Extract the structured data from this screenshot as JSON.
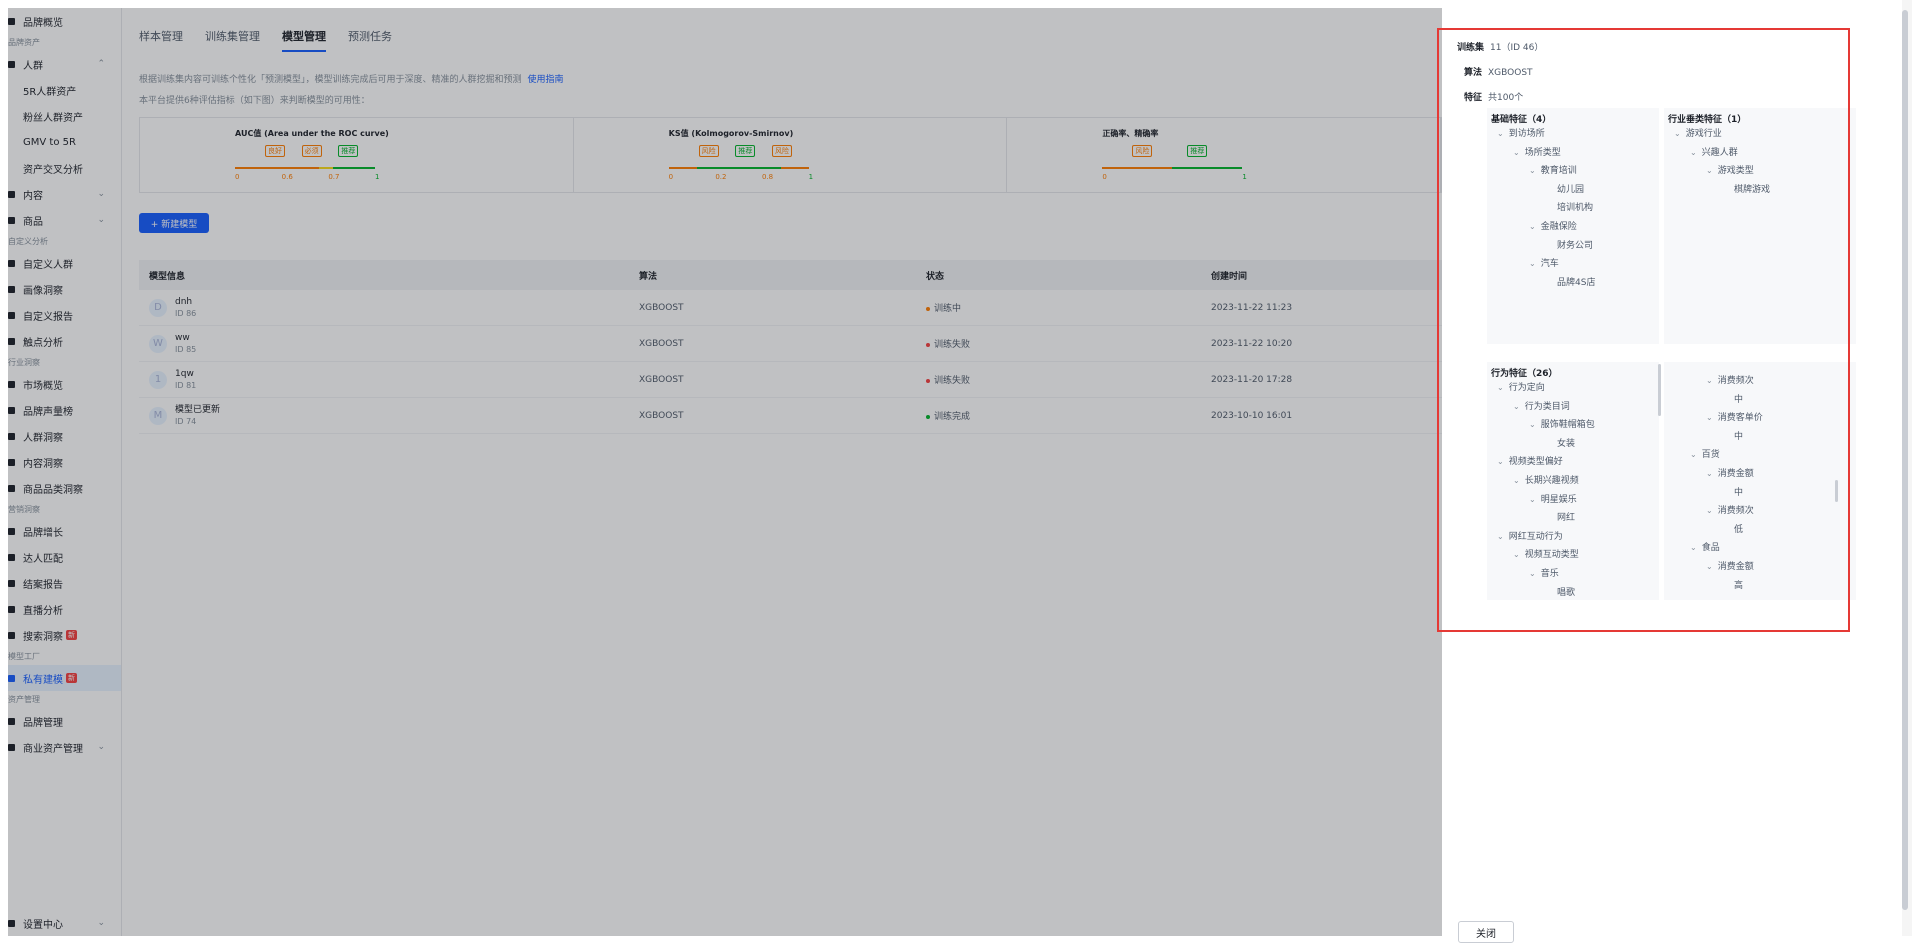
{
  "sidebar": {
    "entries": [
      {
        "type": "item",
        "label": "品牌概览"
      },
      {
        "type": "group",
        "label": "品牌资产"
      },
      {
        "type": "item",
        "label": "人群",
        "chev": "^"
      },
      {
        "type": "sub",
        "label": "5R人群资产"
      },
      {
        "type": "sub",
        "label": "粉丝人群资产"
      },
      {
        "type": "sub",
        "label": "GMV to 5R"
      },
      {
        "type": "sub",
        "label": "资产交叉分析"
      },
      {
        "type": "item",
        "label": "内容",
        "chev": "v"
      },
      {
        "type": "item",
        "label": "商品",
        "chev": "v"
      },
      {
        "type": "group",
        "label": "自定义分析"
      },
      {
        "type": "item",
        "label": "自定义人群"
      },
      {
        "type": "item",
        "label": "画像洞察"
      },
      {
        "type": "item",
        "label": "自定义报告"
      },
      {
        "type": "item",
        "label": "触点分析"
      },
      {
        "type": "group",
        "label": "行业洞察"
      },
      {
        "type": "item",
        "label": "市场概览"
      },
      {
        "type": "item",
        "label": "品牌声量榜"
      },
      {
        "type": "item",
        "label": "人群洞察"
      },
      {
        "type": "item",
        "label": "内容洞察"
      },
      {
        "type": "item",
        "label": "商品品类洞察"
      },
      {
        "type": "group",
        "label": "营销洞察"
      },
      {
        "type": "item",
        "label": "品牌增长"
      },
      {
        "type": "item",
        "label": "达人匹配"
      },
      {
        "type": "item",
        "label": "结案报告"
      },
      {
        "type": "item",
        "label": "直播分析"
      },
      {
        "type": "item",
        "label": "搜索洞察",
        "tag": "新"
      },
      {
        "type": "group",
        "label": "模型工厂"
      },
      {
        "type": "item",
        "label": "私有建模",
        "tag": "新",
        "active": true
      },
      {
        "type": "group",
        "label": "资产管理"
      },
      {
        "type": "item",
        "label": "品牌管理"
      },
      {
        "type": "item",
        "label": "商业资产管理",
        "chev": "v"
      }
    ],
    "settings_label": "设置中心"
  },
  "tabs": [
    "样本管理",
    "训练集管理",
    "模型管理",
    "预测任务"
  ],
  "active_tab_index": 2,
  "description": "根据训练集内容可训练个性化「预测模型」，模型训练完成后可用于深度、精准的人群挖掘和预测",
  "guide_link": "使用指南",
  "description2": "本平台提供6种评估指标（如下图）来判断模型的可用性：",
  "metrics": [
    {
      "title": "AUC值 (Area under the ROC curve)",
      "labels": [
        "良好",
        "必须",
        "推荐"
      ],
      "ticks": [
        "0",
        "0.6",
        "0.7",
        "1"
      ]
    },
    {
      "title": "KS值 (Kolmogorov-Smirnov)",
      "labels": [
        "风险",
        "推荐",
        "风险"
      ],
      "ticks": [
        "0",
        "0.2",
        "0.8",
        "1"
      ]
    },
    {
      "title": "正确率、精确率",
      "labels": [
        "风险",
        "推荐"
      ],
      "ticks": [
        "0",
        "1"
      ]
    }
  ],
  "new_model_button": "+ 新建模型",
  "table": {
    "headers": [
      "模型信息",
      "算法",
      "状态",
      "创建时间"
    ],
    "rows": [
      {
        "avatar": "D",
        "name": "dnh",
        "id": "ID 86",
        "algo": "XGBOOST",
        "status": "训练中",
        "status_color": "#ff7d00",
        "time": "2023-11-22 11:23"
      },
      {
        "avatar": "W",
        "name": "ww",
        "id": "ID 85",
        "algo": "XGBOOST",
        "status": "训练失败",
        "status_color": "#f53f3f",
        "time": "2023-11-22 10:20"
      },
      {
        "avatar": "1",
        "name": "1qw",
        "id": "ID 81",
        "algo": "XGBOOST",
        "status": "训练失败",
        "status_color": "#f53f3f",
        "time": "2023-11-20 17:28"
      },
      {
        "avatar": "M",
        "name": "模型已更新",
        "id": "ID 74",
        "algo": "XGBOOST",
        "status": "训练完成",
        "status_color": "#00b42a",
        "time": "2023-10-10 16:01"
      }
    ]
  },
  "drawer": {
    "training_set_label": "训练集",
    "training_set_value": "11（ID 46）",
    "algo_label": "算法",
    "algo_value": "XGBOOST",
    "feature_label": "特征",
    "feature_value": "共100个",
    "basic_title": "基础特征（4）",
    "basic_tree": [
      {
        "d": 0,
        "t": "到访场所",
        "c": true
      },
      {
        "d": 1,
        "t": "场所类型",
        "c": true
      },
      {
        "d": 2,
        "t": "教育培训",
        "c": true
      },
      {
        "d": 3,
        "t": "幼儿园"
      },
      {
        "d": 3,
        "t": "培训机构"
      },
      {
        "d": 2,
        "t": "金融保险",
        "c": true
      },
      {
        "d": 3,
        "t": "财务公司"
      },
      {
        "d": 2,
        "t": "汽车",
        "c": true
      },
      {
        "d": 3,
        "t": "品牌4S店"
      }
    ],
    "industry_title": "行业垂类特征（1）",
    "industry_tree": [
      {
        "d": 0,
        "t": "游戏行业",
        "c": true
      },
      {
        "d": 1,
        "t": "兴趣人群",
        "c": true
      },
      {
        "d": 2,
        "t": "游戏类型",
        "c": true
      },
      {
        "d": 3,
        "t": "棋牌游戏"
      }
    ],
    "behavior_title": "行为特征（26）",
    "behavior_tree": [
      {
        "d": 0,
        "t": "行为定向",
        "c": true
      },
      {
        "d": 1,
        "t": "行为类目词",
        "c": true
      },
      {
        "d": 2,
        "t": "服饰鞋帽箱包",
        "c": true
      },
      {
        "d": 3,
        "t": "女装"
      },
      {
        "d": 0,
        "t": "视频类型偏好",
        "c": true
      },
      {
        "d": 1,
        "t": "长期兴趣视频",
        "c": true
      },
      {
        "d": 2,
        "t": "明星娱乐",
        "c": true
      },
      {
        "d": 3,
        "t": "网红"
      },
      {
        "d": 0,
        "t": "网红互动行为",
        "c": true
      },
      {
        "d": 1,
        "t": "视频互动类型",
        "c": true
      },
      {
        "d": 2,
        "t": "音乐",
        "c": true
      },
      {
        "d": 3,
        "t": "唱歌"
      }
    ],
    "right_tree": [
      {
        "d": 2,
        "t": "消费频次",
        "c": true
      },
      {
        "d": 3,
        "t": "中"
      },
      {
        "d": 2,
        "t": "消费客单价",
        "c": true
      },
      {
        "d": 3,
        "t": "中"
      },
      {
        "d": 1,
        "t": "百货",
        "c": true
      },
      {
        "d": 2,
        "t": "消费金额",
        "c": true
      },
      {
        "d": 3,
        "t": "中"
      },
      {
        "d": 2,
        "t": "消费频次",
        "c": true
      },
      {
        "d": 3,
        "t": "低"
      },
      {
        "d": 1,
        "t": "食品",
        "c": true
      },
      {
        "d": 2,
        "t": "消费金额",
        "c": true
      },
      {
        "d": 3,
        "t": "高"
      }
    ],
    "close_label": "关闭"
  }
}
